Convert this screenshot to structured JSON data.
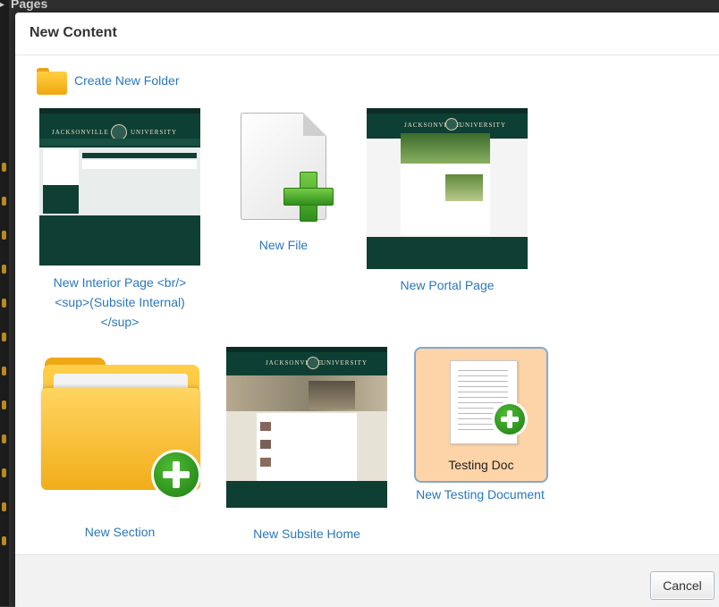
{
  "background": {
    "page_title": "Pages"
  },
  "dialog": {
    "title": "New Content",
    "create_folder_label": "Create New Folder",
    "cancel_label": "Cancel"
  },
  "tiles": [
    {
      "label_lines": [
        "New Interior Page <br/>",
        "<sup>(Subsite Internal)",
        "</sup>"
      ]
    },
    {
      "label": "New File"
    },
    {
      "label": "New Portal Page"
    },
    {
      "label": "New Section"
    },
    {
      "label": "New Subsite Home"
    },
    {
      "label": "New Testing Document",
      "icon_caption": "Testing Doc",
      "selected": true
    }
  ],
  "thumbnail_text": {
    "left": "JACKSONVILLE",
    "right": "UNIVERSITY"
  },
  "colors": {
    "link": "#2a77bd",
    "selected_bg": "#fdd4a8",
    "selected_border": "#84a8cc",
    "ju_green": "#0e3f34",
    "folder_yellow": "#f0a716",
    "plus_green": "#3aa327"
  }
}
